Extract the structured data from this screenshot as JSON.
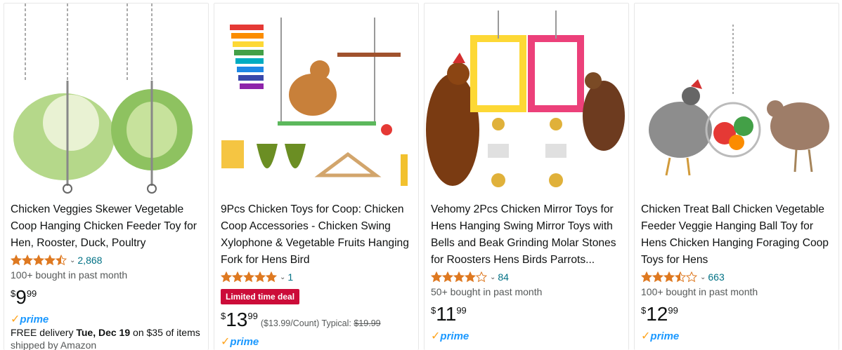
{
  "products": [
    {
      "title": "Chicken Veggies Skewer Vegetable Coop Hanging Chicken Feeder Toy for Hen, Rooster, Duck, Poultry",
      "rating": 4.5,
      "review_count": "2,868",
      "bought": "100+ bought in past month",
      "price_symbol": "$",
      "price_whole": "9",
      "price_fraction": "99",
      "prime": "prime",
      "delivery_prefix": "FREE delivery ",
      "delivery_date": "Tue, Dec 19",
      "delivery_suffix": " on $35 of items",
      "shipped_by": "shipped by Amazon"
    },
    {
      "title": "9Pcs Chicken Toys for Coop: Chicken Coop Accessories - Chicken Swing Xylophone & Vegetable Fruits Hanging Fork for Hens Bird",
      "rating": 5.0,
      "review_count": "1",
      "deal_badge": "Limited time deal",
      "price_symbol": "$",
      "price_whole": "13",
      "price_fraction": "99",
      "unit_price": "($13.99/Count)",
      "typical_label": "Typical: ",
      "typical_price": "$19.99",
      "prime": "prime"
    },
    {
      "title": "Vehomy 2Pcs Chicken Mirror Toys for Hens Hanging Swing Mirror Toys with Bells and Beak Grinding Molar Stones for Roosters Hens Birds Parrots...",
      "rating": 4.0,
      "review_count": "84",
      "bought": "50+ bought in past month",
      "price_symbol": "$",
      "price_whole": "11",
      "price_fraction": "99",
      "prime": "prime"
    },
    {
      "title": "Chicken Treat Ball Chicken Vegetable Feeder Veggie Hanging Ball Toy for Hens Chicken Hanging Foraging Coop Toys for Hens",
      "rating": 3.5,
      "review_count": "663",
      "bought": "100+ bought in past month",
      "price_symbol": "$",
      "price_whole": "12",
      "price_fraction": "99",
      "prime": "prime"
    }
  ],
  "colors": {
    "link": "#007185",
    "star": "#de7921",
    "deal": "#cc0c39",
    "prime_check": "#ffa41c",
    "prime_word": "#1a98ff"
  },
  "icons": {
    "chevron": "chevron-down-icon",
    "star": "star-icon",
    "prime": "prime-check-icon"
  }
}
